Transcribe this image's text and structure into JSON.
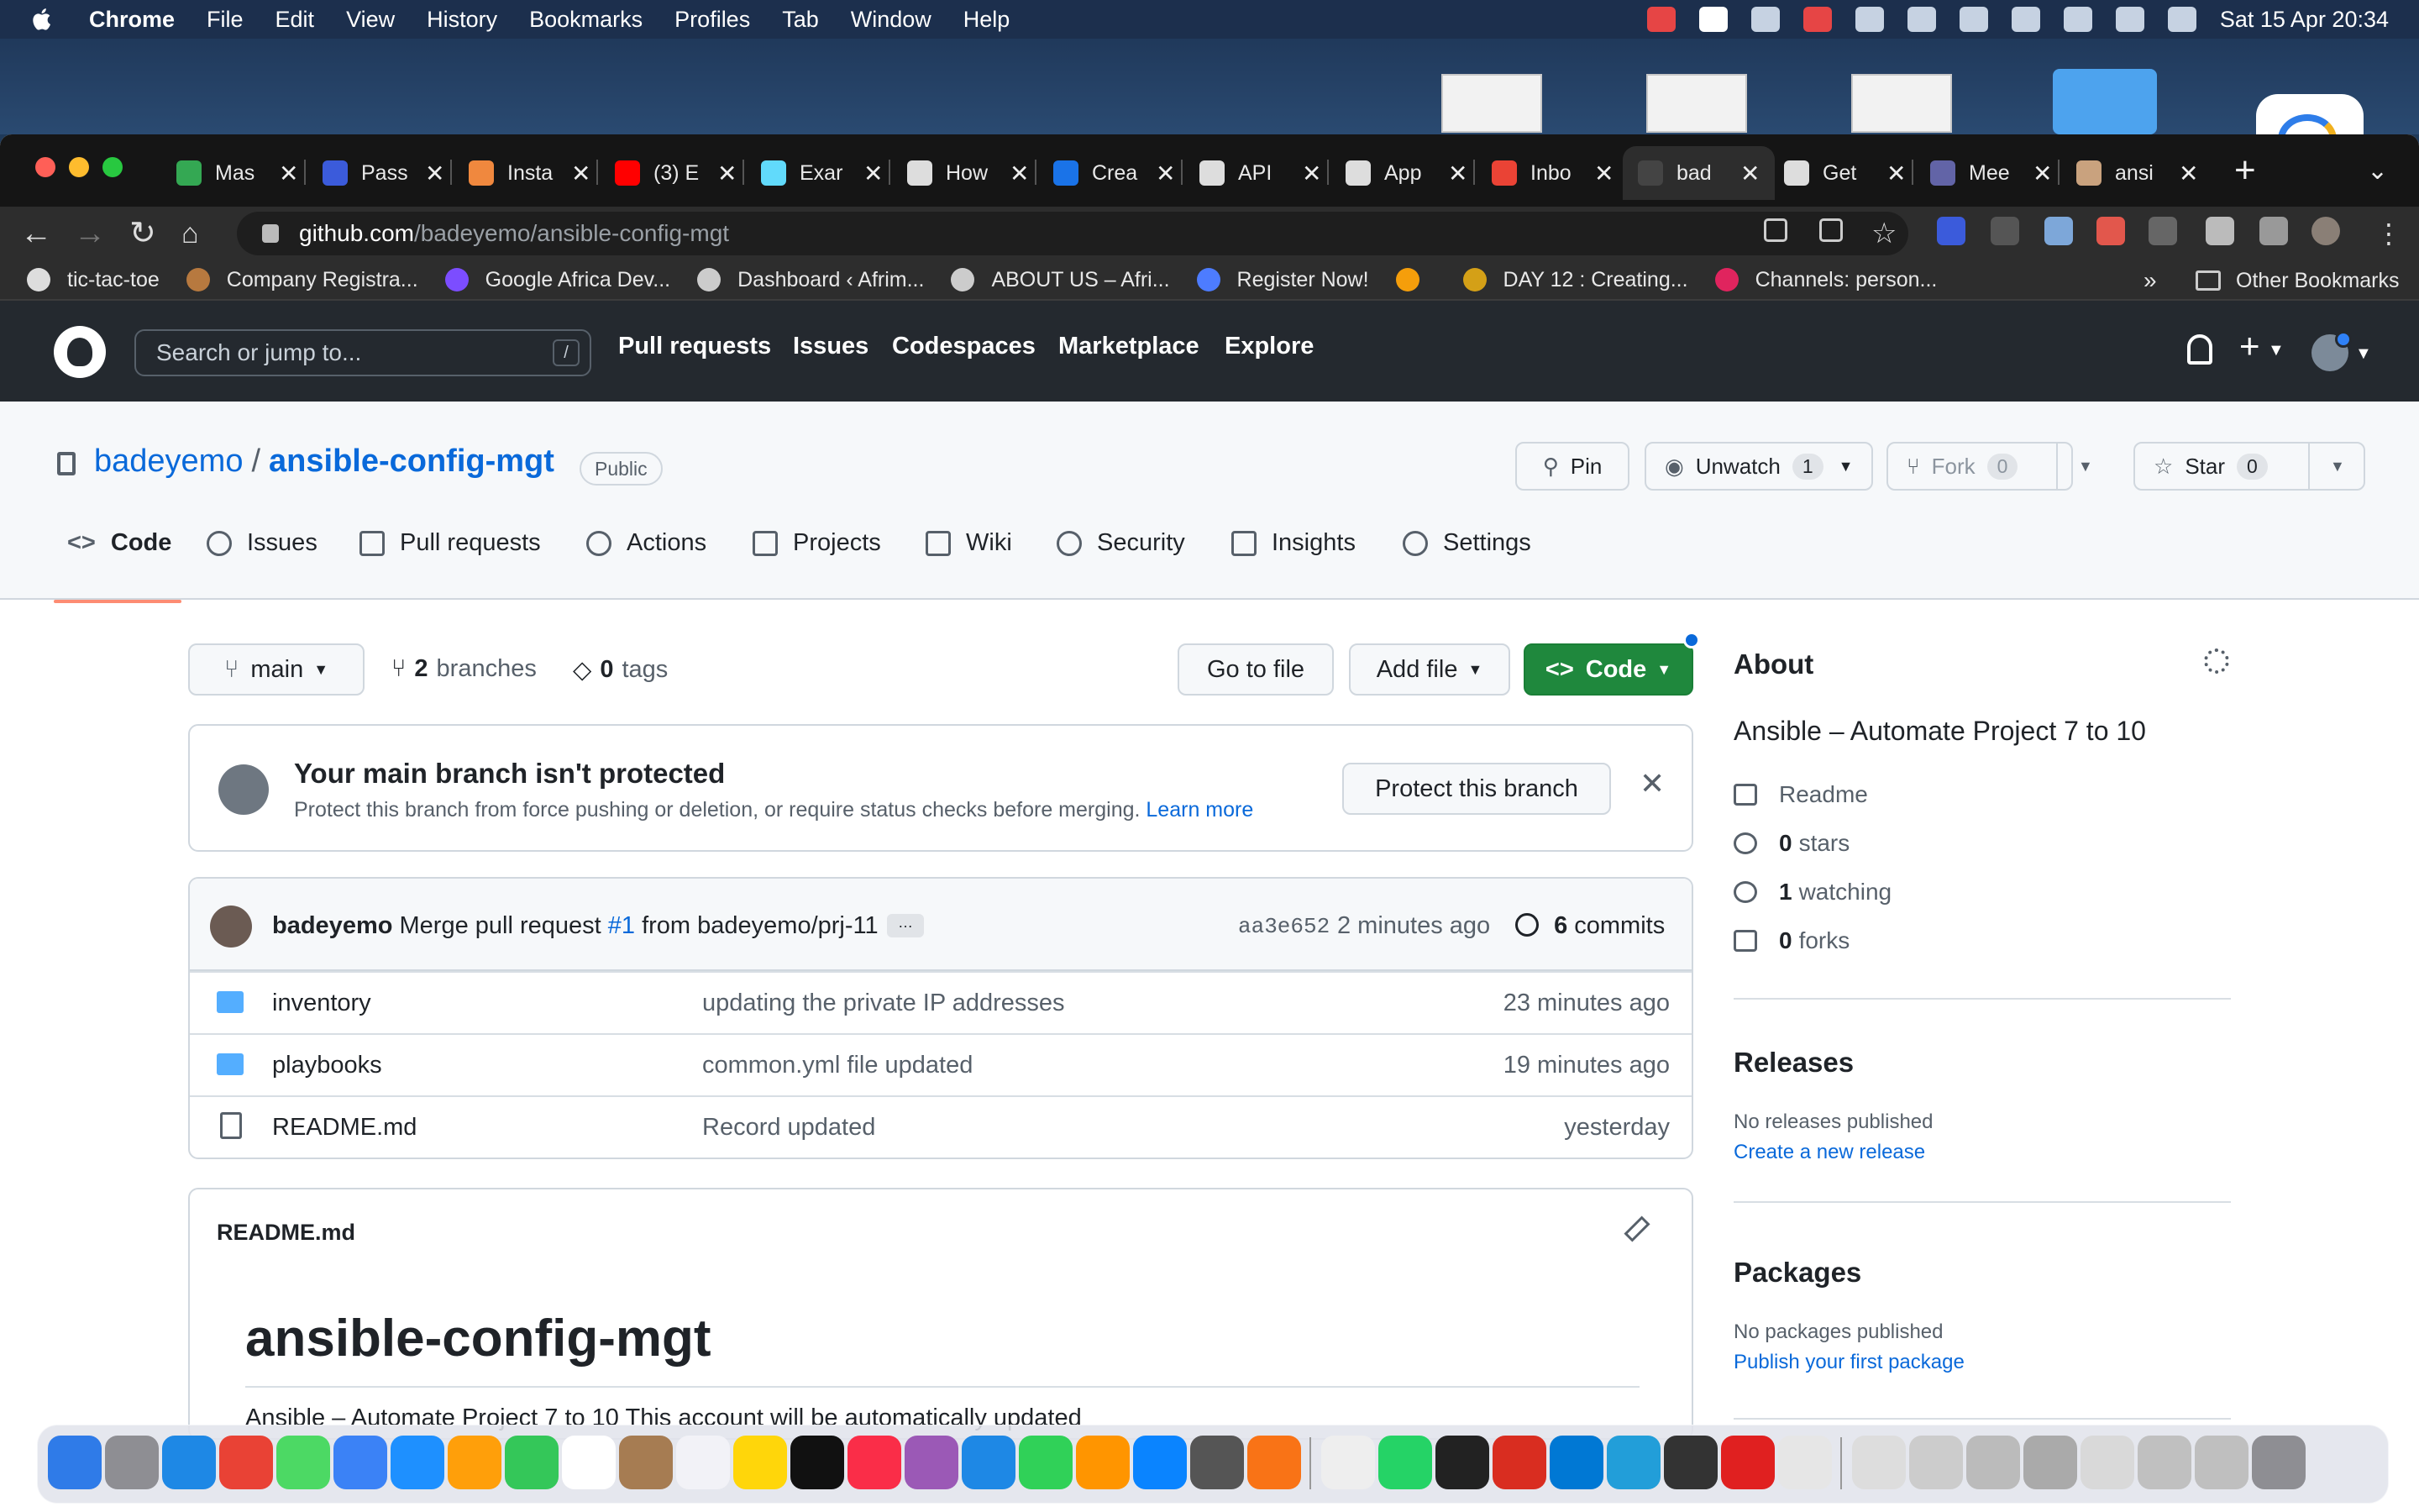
{
  "menubar": {
    "app_name": "Chrome",
    "items": [
      "File",
      "Edit",
      "View",
      "History",
      "Bookmarks",
      "Profiles",
      "Tab",
      "Window",
      "Help"
    ],
    "clock": "Sat 15 Apr  20:34"
  },
  "browser": {
    "tabs": [
      {
        "title": "Mas",
        "icon": "sheets-icon",
        "color": "#34a853"
      },
      {
        "title": "Pass",
        "icon": "zoho-icon",
        "color": "#3b5bdb"
      },
      {
        "title": "Insta",
        "icon": "insta-icon",
        "color": "#f0883e"
      },
      {
        "title": "(3) E",
        "icon": "youtube-icon",
        "color": "#ff0000"
      },
      {
        "title": "Exar",
        "icon": "react-icon",
        "color": "#61dafb"
      },
      {
        "title": "How",
        "icon": "apple-icon",
        "color": "#dddddd"
      },
      {
        "title": "Crea",
        "icon": "app-icon",
        "color": "#1a73e8"
      },
      {
        "title": "API",
        "icon": "apple-icon",
        "color": "#dddddd"
      },
      {
        "title": "App",
        "icon": "apple-icon",
        "color": "#dddddd"
      },
      {
        "title": "Inbo",
        "icon": "gmail-icon",
        "color": "#ea4335"
      },
      {
        "title": "bad",
        "icon": "github-icon",
        "color": "#444444",
        "active": true
      },
      {
        "title": "Get",
        "icon": "apple-icon",
        "color": "#dddddd"
      },
      {
        "title": "Mee",
        "icon": "teams-icon",
        "color": "#6264a7"
      },
      {
        "title": "ansi",
        "icon": "avatar-icon",
        "color": "#c9a27e"
      }
    ],
    "url_host": "github.com",
    "url_path": "/badeyemo/ansible-config-mgt",
    "bookmarks": [
      {
        "label": "tic-tac-toe",
        "color": "#dddddd"
      },
      {
        "label": "Company Registra...",
        "color": "#b7793f"
      },
      {
        "label": "Google Africa Dev...",
        "color": "#7c4dff"
      },
      {
        "label": "Dashboard ‹ Afrim...",
        "color": "#cccccc"
      },
      {
        "label": "ABOUT US – Afri...",
        "color": "#cccccc"
      },
      {
        "label": "Register Now!",
        "color": "#4d7cff"
      },
      {
        "label": "",
        "color": "#f59e0b"
      },
      {
        "label": "DAY 12 : Creating...",
        "color": "#d4a017"
      },
      {
        "label": "Channels: person...",
        "color": "#e0245e"
      }
    ],
    "bookmarks_more": "»",
    "other_bookmarks": "Other Bookmarks"
  },
  "github": {
    "search_placeholder": "Search or jump to...",
    "search_key": "/",
    "nav": [
      "Pull requests",
      "Issues",
      "Codespaces",
      "Marketplace",
      "Explore"
    ],
    "owner": "badeyemo",
    "separator": "/",
    "repo": "ansible-config-mgt",
    "visibility": "Public",
    "actions": {
      "pin": "Pin",
      "unwatch": "Unwatch",
      "watch_count": "1",
      "fork": "Fork",
      "fork_count": "0",
      "star": "Star",
      "star_count": "0"
    },
    "tabs": [
      "Code",
      "Issues",
      "Pull requests",
      "Actions",
      "Projects",
      "Wiki",
      "Security",
      "Insights",
      "Settings"
    ],
    "branch": "main",
    "branches_count": "2",
    "branches_label": "branches",
    "tags_count": "0",
    "tags_label": "tags",
    "go_to_file": "Go to file",
    "add_file": "Add file",
    "code_button": "Code",
    "protect": {
      "title": "Your main branch isn't protected",
      "desc": "Protect this branch from force pushing or deletion, or require status checks before merging.",
      "learn_more": "Learn more",
      "button": "Protect this branch"
    },
    "commit": {
      "author": "badeyemo",
      "msg_prefix": "Merge pull request",
      "pr": "#1",
      "msg_suffix": "from badeyemo/prj-11",
      "ellipsis": "…",
      "sha": "aa3e652",
      "time": "2 minutes ago",
      "count": "6",
      "count_label": "commits"
    },
    "files": [
      {
        "name": "inventory",
        "type": "folder",
        "message": "updating the private IP addresses",
        "time": "23 minutes ago"
      },
      {
        "name": "playbooks",
        "type": "folder",
        "message": "common.yml file updated",
        "time": "19 minutes ago"
      },
      {
        "name": "README.md",
        "type": "file",
        "message": "Record updated",
        "time": "yesterday"
      }
    ],
    "readme": {
      "label": "README.md",
      "heading": "ansible-config-mgt",
      "text": "Ansible – Automate Project 7 to 10 This account will be automatically updated"
    },
    "about": {
      "title": "About",
      "description": "Ansible – Automate Project 7 to 10",
      "readme": "Readme",
      "stars_count": "0",
      "stars_label": "stars",
      "watching_count": "1",
      "watching_label": "watching",
      "forks_count": "0",
      "forks_label": "forks"
    },
    "releases": {
      "title": "Releases",
      "none": "No releases published",
      "link": "Create a new release"
    },
    "packages": {
      "title": "Packages",
      "none": "No packages published",
      "link": "Publish your first package"
    }
  },
  "dock": {
    "colors": [
      "#2f7be8",
      "#8e8e93",
      "#1e88e5",
      "#e94235",
      "#4cd964",
      "#3b82f6",
      "#1e90ff",
      "#ff9f0a",
      "#34c759",
      "#ffffff",
      "#a67c52",
      "#f2f2f7",
      "#ffd60a",
      "#111111",
      "#fa2d48",
      "#9b59b6",
      "#1e88e5",
      "#30d158",
      "#ff9500",
      "#0a84ff",
      "#555555",
      "#f97316",
      "#eeeeee",
      "#25d366",
      "#222222",
      "#d92d20",
      "#0078d4",
      "#229ed9",
      "#333333",
      "#e02020",
      "#e6e6e6",
      "#dddddd",
      "#cccccc",
      "#bbbbbb",
      "#aaaaaa",
      "#d9d9d9",
      "#c0c0c0",
      "#bfbfbf",
      "#8e8e93"
    ]
  }
}
